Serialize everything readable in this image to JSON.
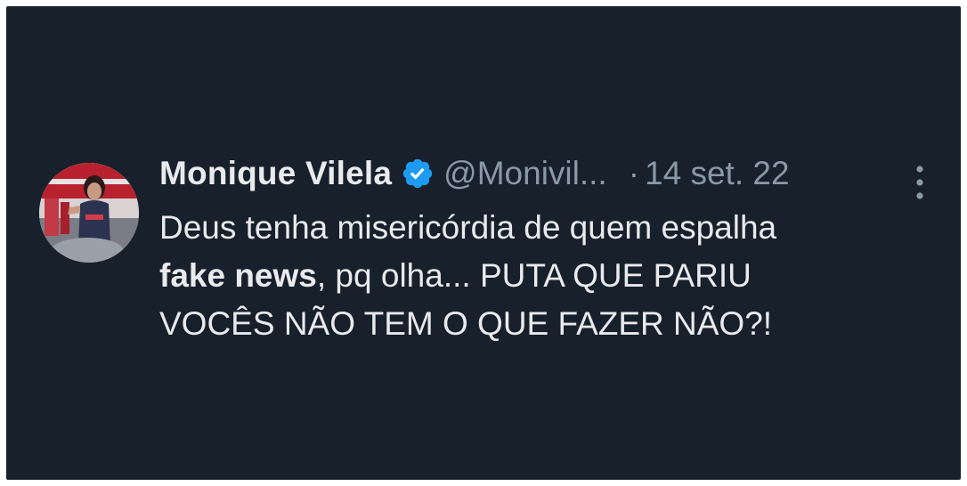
{
  "tweet": {
    "display_name": "Monique Vilela",
    "handle": "@Monivil...",
    "separator": "·",
    "date": "14 set. 22",
    "text": {
      "part1": "Deus tenha misericórdia de quem espalha",
      "bold": "fake news",
      "part2": ", pq olha... PUTA QUE PARIU",
      "part3": "VOCÊS NÃO TEM O QUE FAZER NÃO?!"
    },
    "icons": {
      "verified": "verified-badge-icon",
      "more": "more-vertical-icon"
    },
    "colors": {
      "background": "#17202b",
      "primary_text": "#e8eaed",
      "secondary_text": "#8b98a5",
      "verified": "#1d9bf0"
    }
  }
}
